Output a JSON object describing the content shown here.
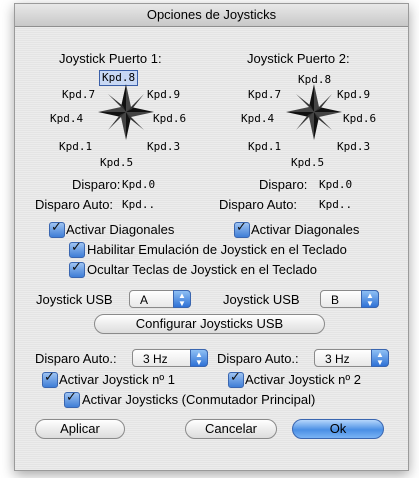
{
  "window": {
    "title": "Opciones de Joysticks"
  },
  "joystick1": {
    "title": "Joystick Puerto 1:",
    "keys": {
      "n": "Kpd.8",
      "nw": "Kpd.7",
      "ne": "Kpd.9",
      "w": "Kpd.4",
      "e": "Kpd.6",
      "sw": "Kpd.1",
      "se": "Kpd.3",
      "s": "Kpd.5"
    },
    "fire_label": "Disparo:",
    "fire_value": "Kpd.0",
    "autofire_label": "Disparo Auto:",
    "autofire_value": "Kpd..",
    "diagonals_label": "Activar Diagonales"
  },
  "joystick2": {
    "title": "Joystick Puerto 2:",
    "keys": {
      "n": "Kpd.8",
      "nw": "Kpd.7",
      "ne": "Kpd.9",
      "w": "Kpd.4",
      "e": "Kpd.6",
      "sw": "Kpd.1",
      "se": "Kpd.3",
      "s": "Kpd.5"
    },
    "fire_label": "Disparo:",
    "fire_value": "Kpd.0",
    "autofire_label": "Disparo Auto:",
    "autofire_value": "Kpd..",
    "diagonals_label": "Activar Diagonales"
  },
  "options": {
    "emulation_label": "Habilitar Emulación de Joystick en el Teclado",
    "hide_keys_label": "Ocultar Teclas de Joystick en el Teclado"
  },
  "usb": {
    "label1": "Joystick USB",
    "value1": "A",
    "label2": "Joystick USB",
    "value2": "B",
    "configure_button": "Configurar Joysticks USB"
  },
  "autofire": {
    "label1": "Disparo Auto.:",
    "value1": "3 Hz",
    "label2": "Disparo Auto.:",
    "value2": "3 Hz",
    "enable1": "Activar Joystick nº 1",
    "enable2": "Activar Joystick nº 2",
    "master": "Activar Joysticks (Conmutador Principal)"
  },
  "buttons": {
    "apply": "Aplicar",
    "cancel": "Cancelar",
    "ok": "Ok"
  }
}
